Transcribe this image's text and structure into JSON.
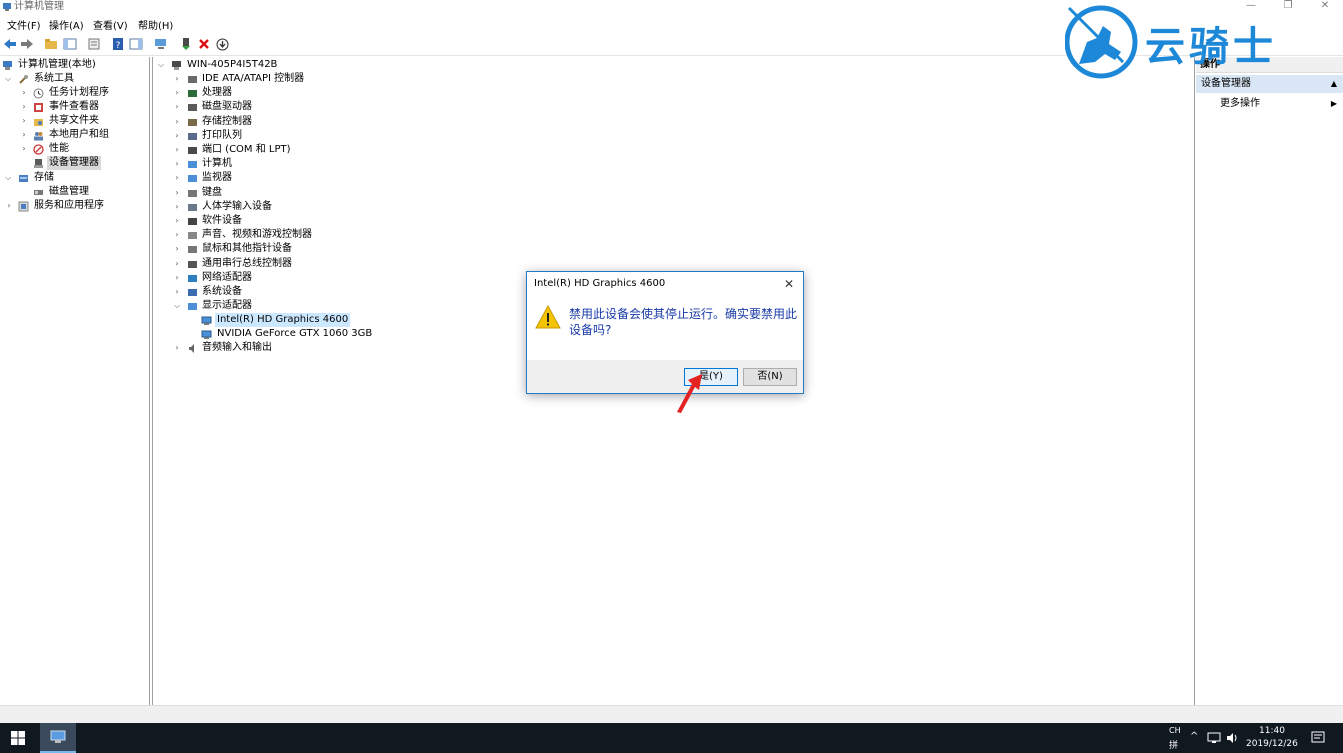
{
  "window": {
    "title": "计算机管理",
    "minimize": "—",
    "restore": "❐",
    "close": "✕"
  },
  "menu": {
    "items": [
      "文件(F)",
      "操作(A)",
      "查看(V)",
      "帮助(H)"
    ]
  },
  "left_tree": {
    "root": "计算机管理(本地)",
    "system_tools": "系统工具",
    "children": [
      "任务计划程序",
      "事件查看器",
      "共享文件夹",
      "本地用户和组",
      "性能",
      "设备管理器"
    ],
    "storage": "存储",
    "disk_mgmt": "磁盘管理",
    "services": "服务和应用程序"
  },
  "device_tree": {
    "computer": "WIN-405P4I5T42B",
    "categories": [
      "IDE ATA/ATAPI 控制器",
      "处理器",
      "磁盘驱动器",
      "存储控制器",
      "打印队列",
      "端口 (COM 和 LPT)",
      "计算机",
      "监视器",
      "键盘",
      "人体学输入设备",
      "软件设备",
      "声音、视频和游戏控制器",
      "鼠标和其他指针设备",
      "通用串行总线控制器",
      "网络适配器",
      "系统设备",
      "显示适配器"
    ],
    "display_children": [
      "Intel(R) HD Graphics 4600",
      "NVIDIA GeForce GTX 1060 3GB"
    ],
    "last": "音频输入和输出"
  },
  "actions": {
    "header": "操作",
    "section": "设备管理器",
    "more": "更多操作"
  },
  "dialog": {
    "title": "Intel(R) HD Graphics 4600",
    "message": "禁用此设备会使其停止运行。确实要禁用此设备吗?",
    "yes": "是(Y)",
    "no": "否(N)"
  },
  "taskbar": {
    "lang_top": "CH",
    "lang_bottom": "拼",
    "time": "11:40",
    "date": "2019/12/26"
  },
  "watermark": {
    "text": "云骑士"
  },
  "colors": {
    "accent": "#0078d7",
    "dialog_text": "#1a3aa8",
    "watermark": "#1e88d8",
    "taskbar": "#101820",
    "selection": "#cce8ff"
  }
}
